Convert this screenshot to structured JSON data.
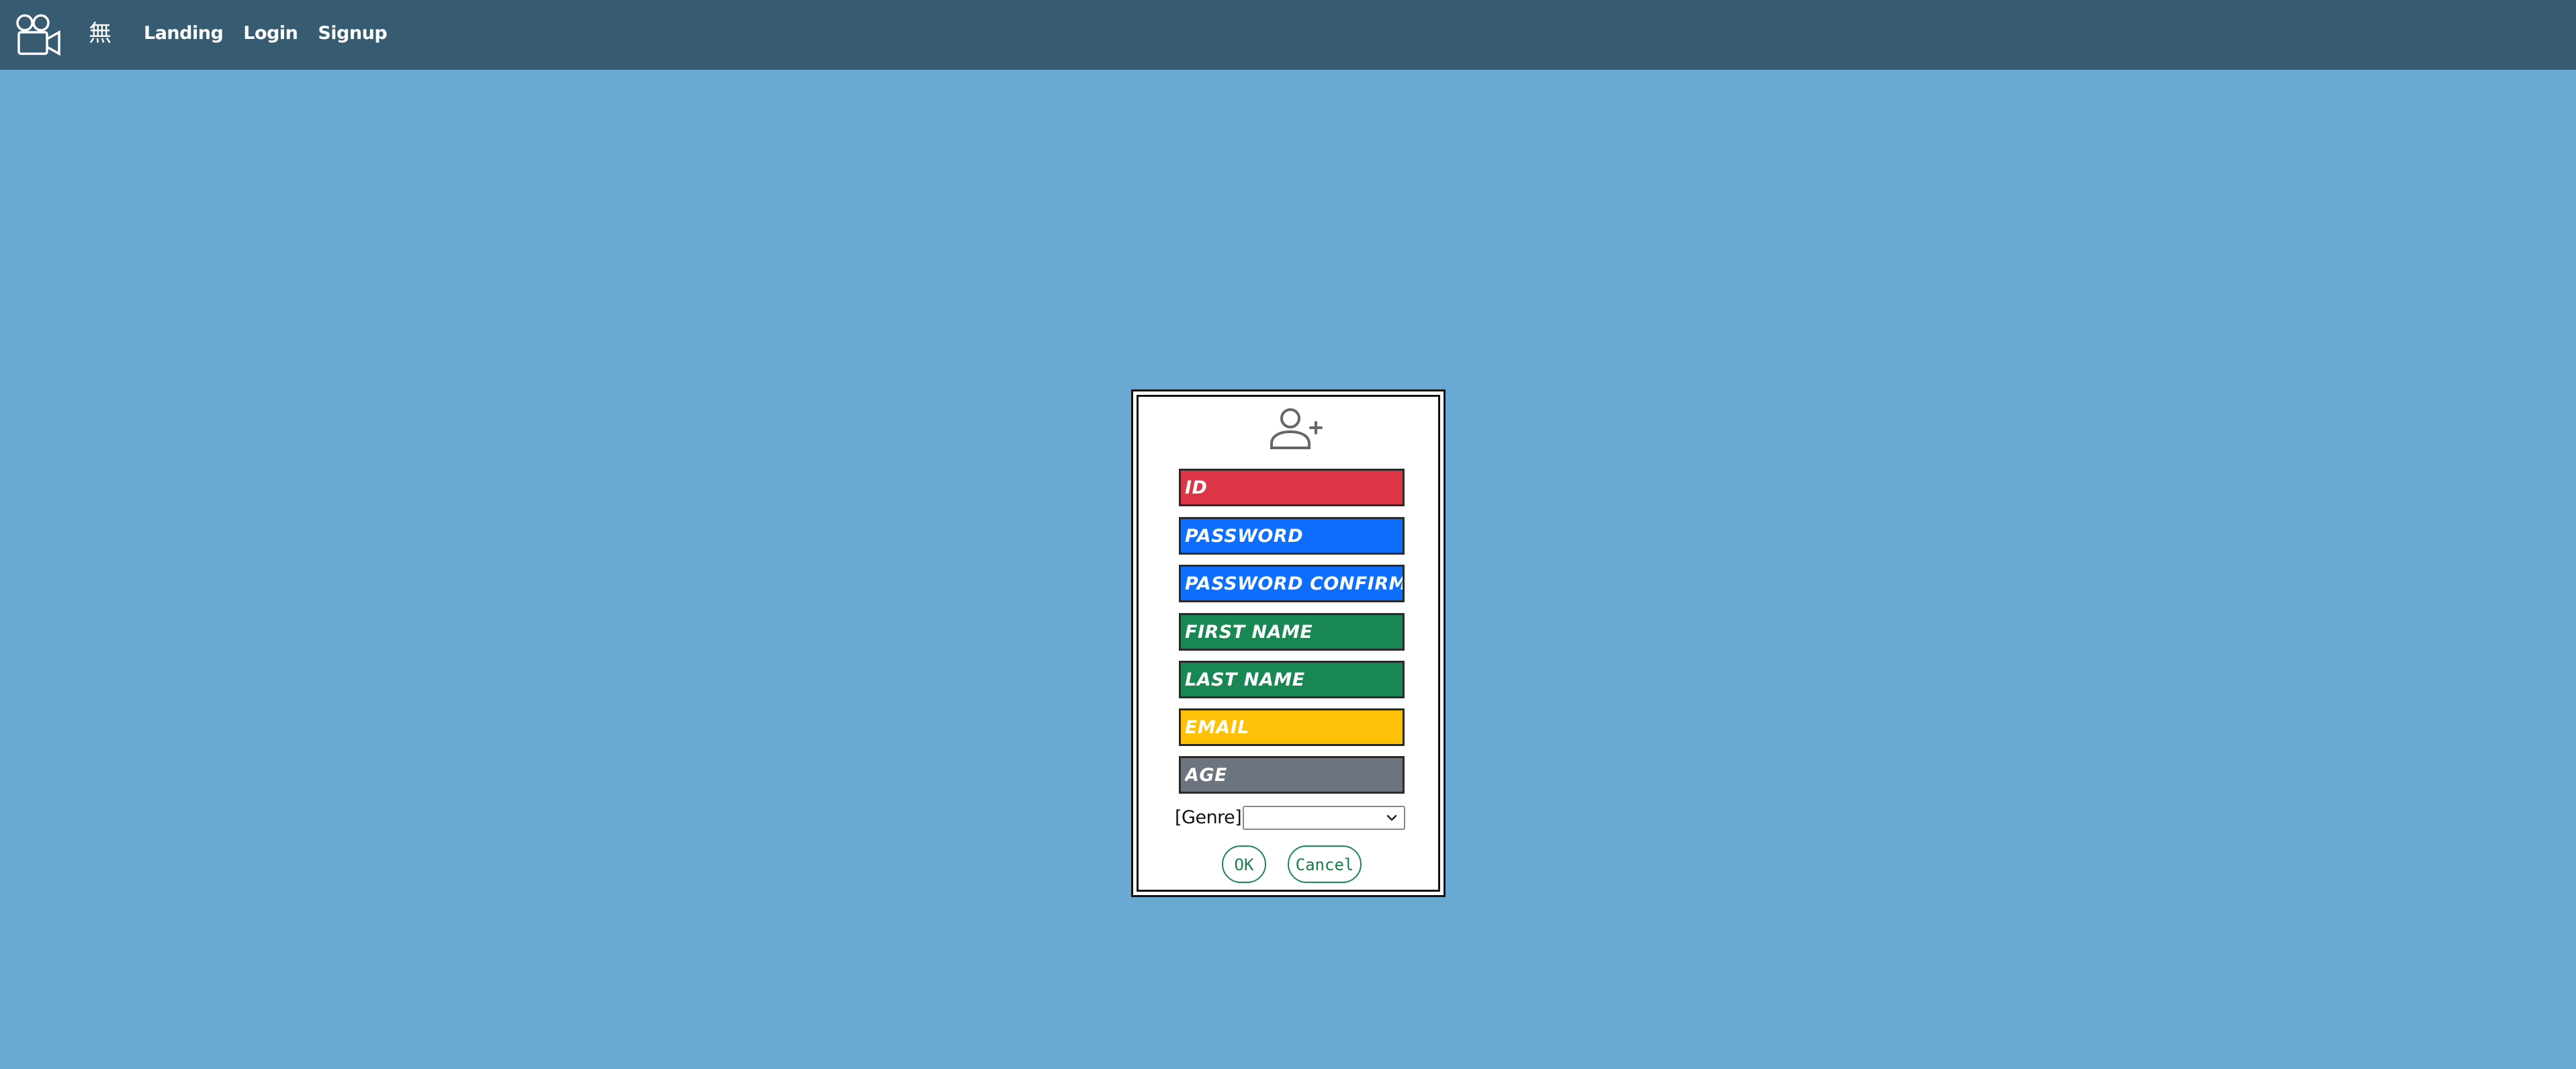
{
  "navbar": {
    "brand_glyph": "無",
    "links": [
      "Landing",
      "Login",
      "Signup"
    ],
    "logo_icon": "video-camera-icon",
    "background": "#375b71"
  },
  "page": {
    "background": "#6aaad2"
  },
  "signup_form": {
    "header_icon": "add-user-icon",
    "fields": [
      {
        "placeholder": "ID",
        "color": "#dc3545"
      },
      {
        "placeholder": "PASSWORD",
        "color": "#0d6efd"
      },
      {
        "placeholder": "PASSWORD CONFIRMATION",
        "color": "#0d6efd"
      },
      {
        "placeholder": "FIRST NAME",
        "color": "#198754"
      },
      {
        "placeholder": "LAST NAME",
        "color": "#198754"
      },
      {
        "placeholder": "EMAIL",
        "color": "#ffc107"
      },
      {
        "placeholder": "AGE",
        "color": "#6c757d"
      }
    ],
    "genre_label": "[Genre]",
    "genre_value": "",
    "ok_label": "OK",
    "cancel_label": "Cancel"
  }
}
